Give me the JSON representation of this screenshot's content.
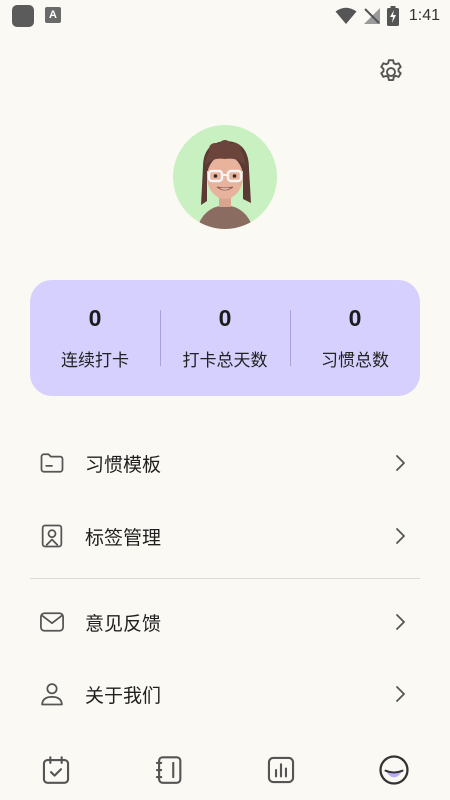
{
  "status_bar": {
    "time": "1:41",
    "a_badge": "A"
  },
  "stats": [
    {
      "value": "0",
      "label": "连续打卡"
    },
    {
      "value": "0",
      "label": "打卡总天数"
    },
    {
      "value": "0",
      "label": "习惯总数"
    }
  ],
  "menu": [
    {
      "label": "习惯模板",
      "icon": "folder-icon"
    },
    {
      "label": "标签管理",
      "icon": "tag-portrait-icon"
    },
    {
      "label": "意见反馈",
      "icon": "mail-icon"
    },
    {
      "label": "关于我们",
      "icon": "user-icon"
    }
  ],
  "nav": [
    {
      "icon": "calendar-check-icon"
    },
    {
      "icon": "notebook-icon"
    },
    {
      "icon": "chart-icon"
    },
    {
      "icon": "profile-face-icon",
      "active": true
    }
  ],
  "colors": {
    "accent": "#d6d0fe",
    "active_nav": "#b9adf7",
    "background": "#fbf9f4"
  }
}
